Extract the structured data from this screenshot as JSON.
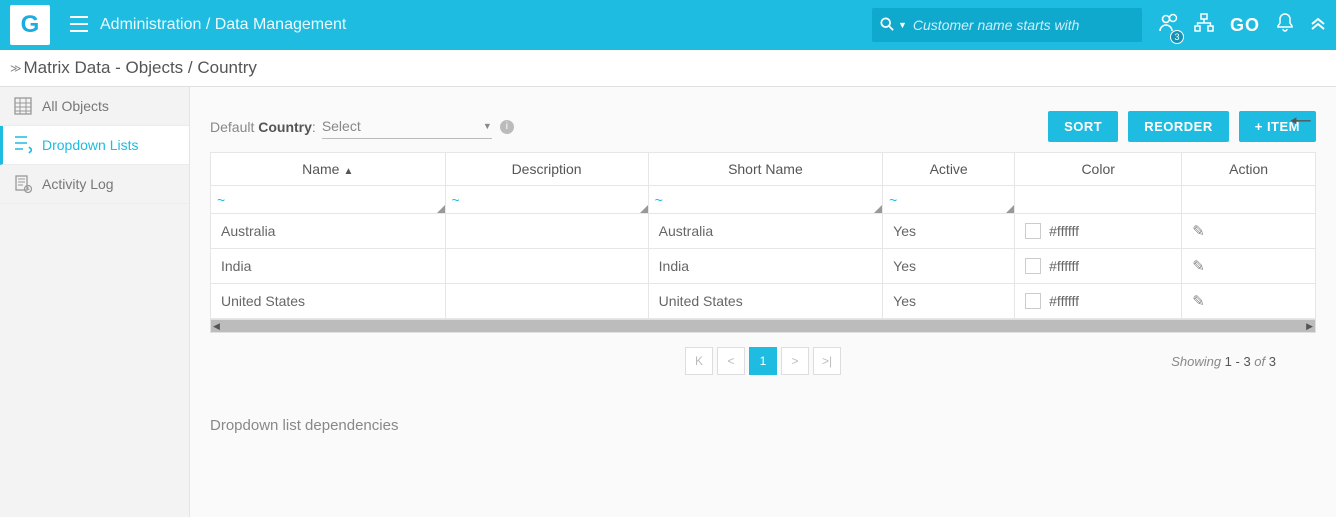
{
  "topbar": {
    "logo": "G",
    "breadcrumb": "Administration / Data Management",
    "search_placeholder": "Customer name starts with",
    "go_label": "GO",
    "badge_count": "3"
  },
  "page_title": "Matrix Data - Objects / Country",
  "sidebar": {
    "items": [
      {
        "label": "All Objects"
      },
      {
        "label": "Dropdown Lists"
      },
      {
        "label": "Activity Log"
      }
    ]
  },
  "controls": {
    "default_prefix": "Default ",
    "default_strong": "Country",
    "default_suffix": ":",
    "select_placeholder": "Select",
    "sort_btn": "SORT",
    "reorder_btn": "REORDER",
    "item_btn": "+ ITEM"
  },
  "table": {
    "headers": [
      "Name",
      "Description",
      "Short Name",
      "Active",
      "Color",
      "Action"
    ],
    "rows": [
      {
        "name": "Australia",
        "description": "",
        "short_name": "Australia",
        "active": "Yes",
        "color": "#ffffff"
      },
      {
        "name": "India",
        "description": "",
        "short_name": "India",
        "active": "Yes",
        "color": "#ffffff"
      },
      {
        "name": "United States",
        "description": "",
        "short_name": "United States",
        "active": "Yes",
        "color": "#ffffff"
      }
    ]
  },
  "pager": {
    "current": "1",
    "showing_prefix": "Showing ",
    "showing_range": "1 - 3",
    "showing_mid": " of ",
    "showing_total": "3"
  },
  "deps_title": "Dropdown list dependencies"
}
